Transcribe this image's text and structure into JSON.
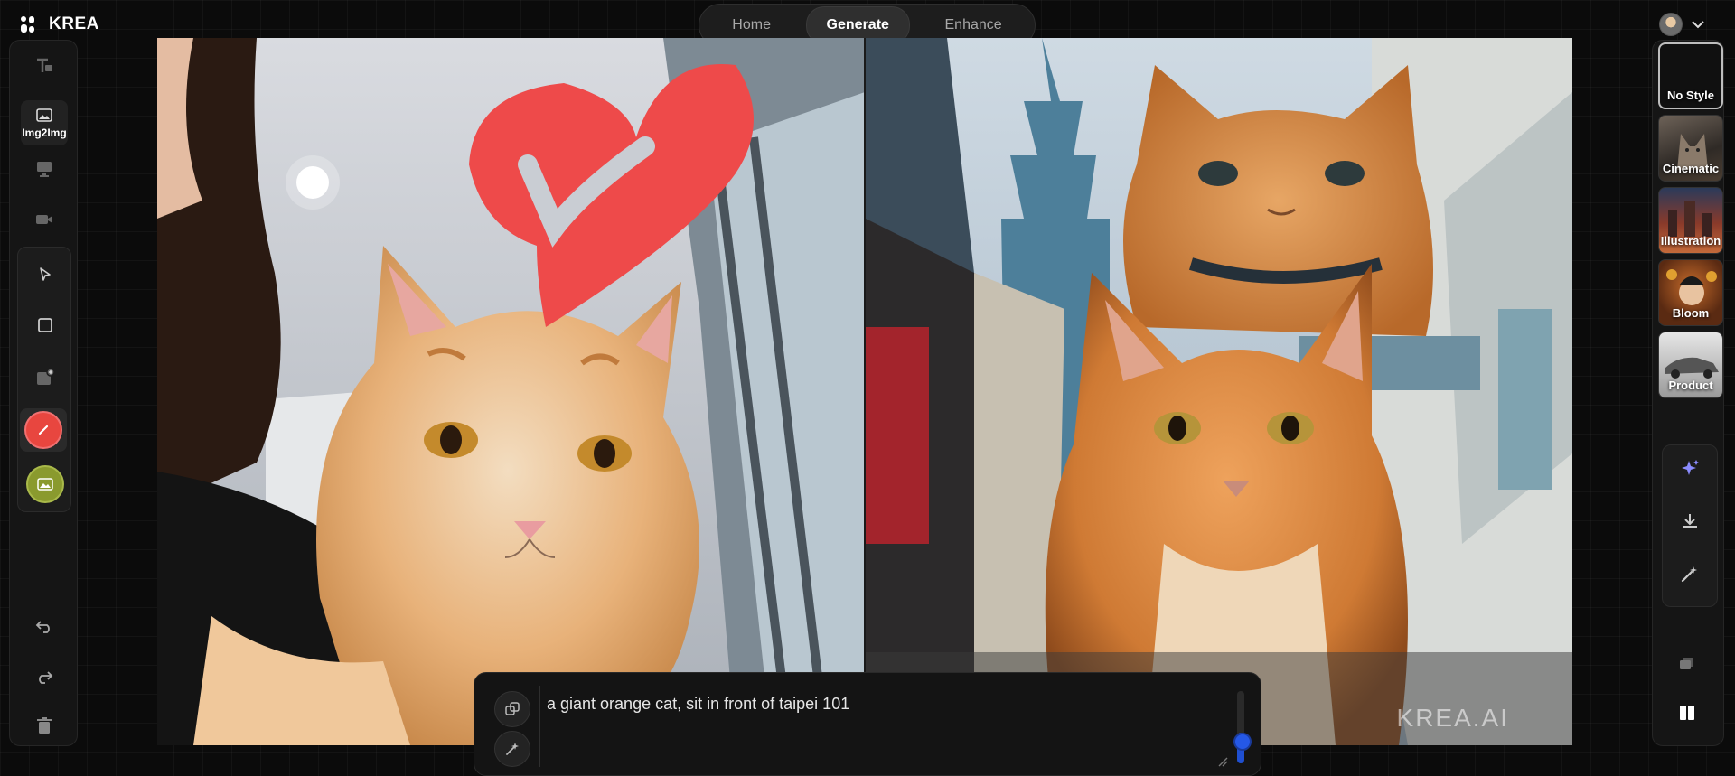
{
  "app": {
    "name": "KREA"
  },
  "nav": {
    "tabs": [
      {
        "label": "Home"
      },
      {
        "label": "Generate"
      },
      {
        "label": "Enhance"
      }
    ],
    "active": "Generate"
  },
  "left_toolbar": {
    "selected_tool": {
      "label": "Img2Img"
    }
  },
  "prompt": {
    "text": "a giant orange cat, sit in front of  taipei 101",
    "strength": 0.32
  },
  "styles": [
    {
      "label": "No Style",
      "selected": true
    },
    {
      "label": "Cinematic"
    },
    {
      "label": "Illustration"
    },
    {
      "label": "Bloom"
    },
    {
      "label": "Product"
    }
  ],
  "canvas": {
    "watermark": "KREA.AI"
  },
  "colors": {
    "accent": "#2558e6",
    "brush": "#e8463f",
    "heart": "#ee4a4a"
  }
}
